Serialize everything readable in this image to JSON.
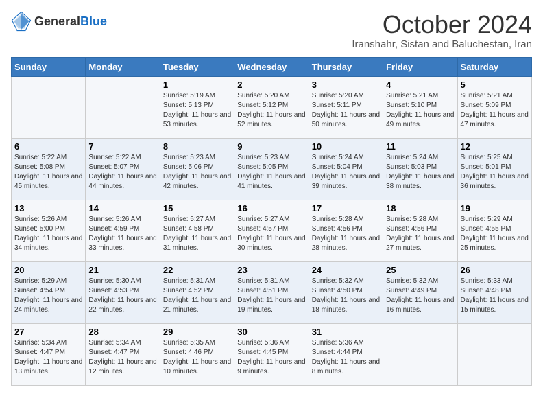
{
  "header": {
    "logo_general": "General",
    "logo_blue": "Blue",
    "month_title": "October 2024",
    "location": "Iranshahr, Sistan and Baluchestan, Iran"
  },
  "weekdays": [
    "Sunday",
    "Monday",
    "Tuesday",
    "Wednesday",
    "Thursday",
    "Friday",
    "Saturday"
  ],
  "weeks": [
    [
      {
        "day": "",
        "sunrise": "",
        "sunset": "",
        "daylight": ""
      },
      {
        "day": "",
        "sunrise": "",
        "sunset": "",
        "daylight": ""
      },
      {
        "day": "1",
        "sunrise": "Sunrise: 5:19 AM",
        "sunset": "Sunset: 5:13 PM",
        "daylight": "Daylight: 11 hours and 53 minutes."
      },
      {
        "day": "2",
        "sunrise": "Sunrise: 5:20 AM",
        "sunset": "Sunset: 5:12 PM",
        "daylight": "Daylight: 11 hours and 52 minutes."
      },
      {
        "day": "3",
        "sunrise": "Sunrise: 5:20 AM",
        "sunset": "Sunset: 5:11 PM",
        "daylight": "Daylight: 11 hours and 50 minutes."
      },
      {
        "day": "4",
        "sunrise": "Sunrise: 5:21 AM",
        "sunset": "Sunset: 5:10 PM",
        "daylight": "Daylight: 11 hours and 49 minutes."
      },
      {
        "day": "5",
        "sunrise": "Sunrise: 5:21 AM",
        "sunset": "Sunset: 5:09 PM",
        "daylight": "Daylight: 11 hours and 47 minutes."
      }
    ],
    [
      {
        "day": "6",
        "sunrise": "Sunrise: 5:22 AM",
        "sunset": "Sunset: 5:08 PM",
        "daylight": "Daylight: 11 hours and 45 minutes."
      },
      {
        "day": "7",
        "sunrise": "Sunrise: 5:22 AM",
        "sunset": "Sunset: 5:07 PM",
        "daylight": "Daylight: 11 hours and 44 minutes."
      },
      {
        "day": "8",
        "sunrise": "Sunrise: 5:23 AM",
        "sunset": "Sunset: 5:06 PM",
        "daylight": "Daylight: 11 hours and 42 minutes."
      },
      {
        "day": "9",
        "sunrise": "Sunrise: 5:23 AM",
        "sunset": "Sunset: 5:05 PM",
        "daylight": "Daylight: 11 hours and 41 minutes."
      },
      {
        "day": "10",
        "sunrise": "Sunrise: 5:24 AM",
        "sunset": "Sunset: 5:04 PM",
        "daylight": "Daylight: 11 hours and 39 minutes."
      },
      {
        "day": "11",
        "sunrise": "Sunrise: 5:24 AM",
        "sunset": "Sunset: 5:03 PM",
        "daylight": "Daylight: 11 hours and 38 minutes."
      },
      {
        "day": "12",
        "sunrise": "Sunrise: 5:25 AM",
        "sunset": "Sunset: 5:01 PM",
        "daylight": "Daylight: 11 hours and 36 minutes."
      }
    ],
    [
      {
        "day": "13",
        "sunrise": "Sunrise: 5:26 AM",
        "sunset": "Sunset: 5:00 PM",
        "daylight": "Daylight: 11 hours and 34 minutes."
      },
      {
        "day": "14",
        "sunrise": "Sunrise: 5:26 AM",
        "sunset": "Sunset: 4:59 PM",
        "daylight": "Daylight: 11 hours and 33 minutes."
      },
      {
        "day": "15",
        "sunrise": "Sunrise: 5:27 AM",
        "sunset": "Sunset: 4:58 PM",
        "daylight": "Daylight: 11 hours and 31 minutes."
      },
      {
        "day": "16",
        "sunrise": "Sunrise: 5:27 AM",
        "sunset": "Sunset: 4:57 PM",
        "daylight": "Daylight: 11 hours and 30 minutes."
      },
      {
        "day": "17",
        "sunrise": "Sunrise: 5:28 AM",
        "sunset": "Sunset: 4:56 PM",
        "daylight": "Daylight: 11 hours and 28 minutes."
      },
      {
        "day": "18",
        "sunrise": "Sunrise: 5:28 AM",
        "sunset": "Sunset: 4:56 PM",
        "daylight": "Daylight: 11 hours and 27 minutes."
      },
      {
        "day": "19",
        "sunrise": "Sunrise: 5:29 AM",
        "sunset": "Sunset: 4:55 PM",
        "daylight": "Daylight: 11 hours and 25 minutes."
      }
    ],
    [
      {
        "day": "20",
        "sunrise": "Sunrise: 5:29 AM",
        "sunset": "Sunset: 4:54 PM",
        "daylight": "Daylight: 11 hours and 24 minutes."
      },
      {
        "day": "21",
        "sunrise": "Sunrise: 5:30 AM",
        "sunset": "Sunset: 4:53 PM",
        "daylight": "Daylight: 11 hours and 22 minutes."
      },
      {
        "day": "22",
        "sunrise": "Sunrise: 5:31 AM",
        "sunset": "Sunset: 4:52 PM",
        "daylight": "Daylight: 11 hours and 21 minutes."
      },
      {
        "day": "23",
        "sunrise": "Sunrise: 5:31 AM",
        "sunset": "Sunset: 4:51 PM",
        "daylight": "Daylight: 11 hours and 19 minutes."
      },
      {
        "day": "24",
        "sunrise": "Sunrise: 5:32 AM",
        "sunset": "Sunset: 4:50 PM",
        "daylight": "Daylight: 11 hours and 18 minutes."
      },
      {
        "day": "25",
        "sunrise": "Sunrise: 5:32 AM",
        "sunset": "Sunset: 4:49 PM",
        "daylight": "Daylight: 11 hours and 16 minutes."
      },
      {
        "day": "26",
        "sunrise": "Sunrise: 5:33 AM",
        "sunset": "Sunset: 4:48 PM",
        "daylight": "Daylight: 11 hours and 15 minutes."
      }
    ],
    [
      {
        "day": "27",
        "sunrise": "Sunrise: 5:34 AM",
        "sunset": "Sunset: 4:47 PM",
        "daylight": "Daylight: 11 hours and 13 minutes."
      },
      {
        "day": "28",
        "sunrise": "Sunrise: 5:34 AM",
        "sunset": "Sunset: 4:47 PM",
        "daylight": "Daylight: 11 hours and 12 minutes."
      },
      {
        "day": "29",
        "sunrise": "Sunrise: 5:35 AM",
        "sunset": "Sunset: 4:46 PM",
        "daylight": "Daylight: 11 hours and 10 minutes."
      },
      {
        "day": "30",
        "sunrise": "Sunrise: 5:36 AM",
        "sunset": "Sunset: 4:45 PM",
        "daylight": "Daylight: 11 hours and 9 minutes."
      },
      {
        "day": "31",
        "sunrise": "Sunrise: 5:36 AM",
        "sunset": "Sunset: 4:44 PM",
        "daylight": "Daylight: 11 hours and 8 minutes."
      },
      {
        "day": "",
        "sunrise": "",
        "sunset": "",
        "daylight": ""
      },
      {
        "day": "",
        "sunrise": "",
        "sunset": "",
        "daylight": ""
      }
    ]
  ]
}
